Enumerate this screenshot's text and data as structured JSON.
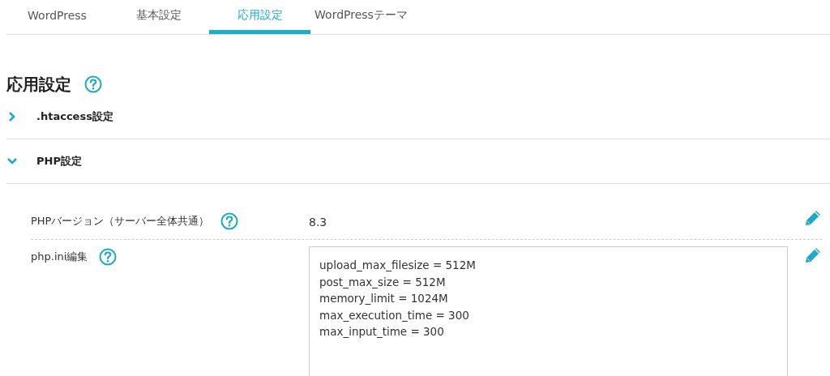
{
  "tabs": [
    {
      "label": "WordPress",
      "selected": false
    },
    {
      "label": "基本設定",
      "selected": false
    },
    {
      "label": "応用設定",
      "selected": true
    },
    {
      "label": "WordPressテーマ",
      "selected": false
    }
  ],
  "heading": {
    "title": "応用設定"
  },
  "sections": [
    {
      "title": ".htaccess設定",
      "expanded": false
    },
    {
      "title": "PHP設定",
      "expanded": true
    }
  ],
  "settings": [
    {
      "kind": "value",
      "label": "PHPバージョン（サーバー全体共通）",
      "value": "8.3"
    },
    {
      "kind": "textarea",
      "label": "php.ini編集",
      "lines": [
        "upload_max_filesize = 512M",
        "post_max_size = 512M",
        "memory_limit = 1024M",
        "max_execution_time = 300",
        "max_input_time = 300"
      ]
    }
  ]
}
